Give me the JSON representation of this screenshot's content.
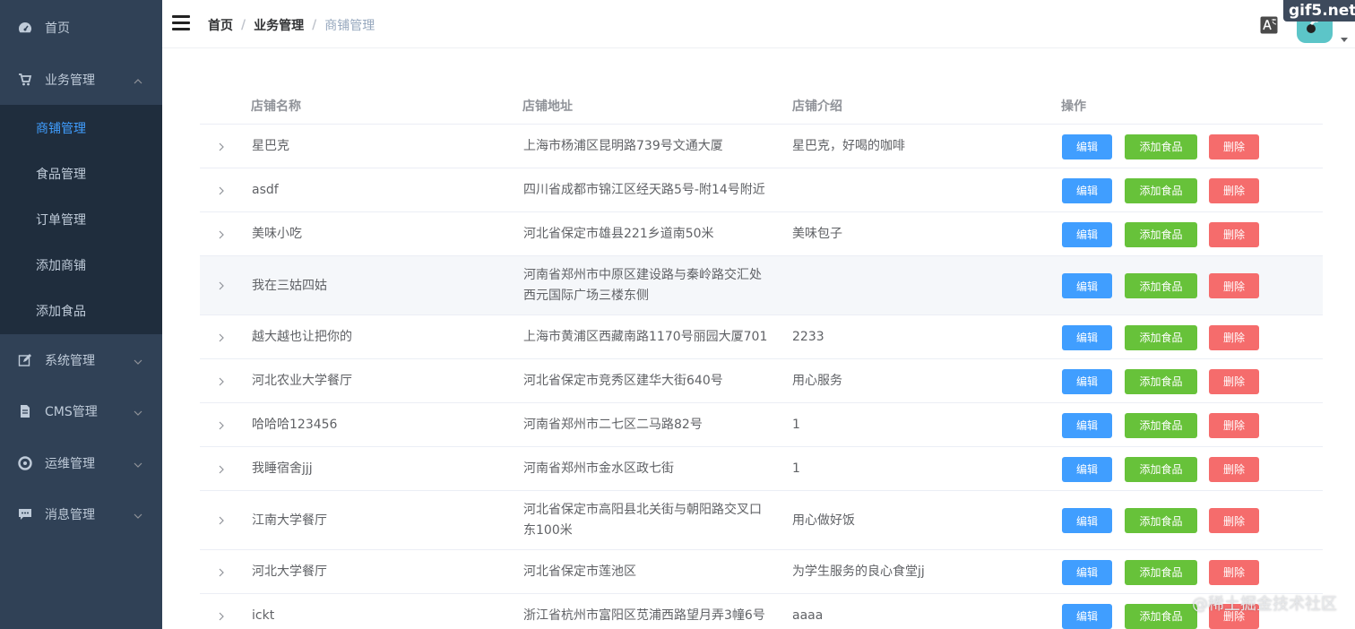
{
  "sidebar": {
    "top_items": [
      {
        "label": "首页",
        "icon": "dashboard-icon"
      },
      {
        "label": "业务管理",
        "icon": "cart-icon",
        "expanded": true
      }
    ],
    "sub_items": [
      {
        "label": "商铺管理",
        "active": true
      },
      {
        "label": "食品管理"
      },
      {
        "label": "订单管理"
      },
      {
        "label": "添加商铺"
      },
      {
        "label": "添加食品"
      }
    ],
    "bottom_items": [
      {
        "label": "系统管理",
        "icon": "edit-icon"
      },
      {
        "label": "CMS管理",
        "icon": "document-icon"
      },
      {
        "label": "运维管理",
        "icon": "settings-icon"
      },
      {
        "label": "消息管理",
        "icon": "message-icon"
      }
    ]
  },
  "header": {
    "breadcrumb": [
      "首页",
      "业务管理",
      "商铺管理"
    ],
    "separator": "/",
    "watermark": "gif5.net"
  },
  "table": {
    "columns": [
      "店铺名称",
      "店铺地址",
      "店铺介绍",
      "操作"
    ],
    "actions": {
      "edit": "编辑",
      "add_food": "添加食品",
      "delete": "删除"
    },
    "rows": [
      {
        "name": "星巴克",
        "address": "上海市杨浦区昆明路739号文通大厦",
        "intro": "星巴克，好喝的咖啡"
      },
      {
        "name": "asdf",
        "address": "四川省成都市锦江区经天路5号-附14号附近",
        "intro": ""
      },
      {
        "name": "美味小吃",
        "address": "河北省保定市雄县221乡道南50米",
        "intro": "美味包子"
      },
      {
        "name": "我在三姑四姑",
        "address": "河南省郑州市中原区建设路与秦岭路交汇处西元国际广场三楼东侧",
        "intro": ""
      },
      {
        "name": "越大越也让把你的",
        "address": "上海市黄浦区西藏南路1170号丽园大厦701",
        "intro": "2233"
      },
      {
        "name": "河北农业大学餐厅",
        "address": "河北省保定市竞秀区建华大街640号",
        "intro": "用心服务"
      },
      {
        "name": "哈哈哈123456",
        "address": "河南省郑州市二七区二马路82号",
        "intro": "1"
      },
      {
        "name": "我睡宿舍jjj",
        "address": "河南省郑州市金水区政七街",
        "intro": "1"
      },
      {
        "name": "江南大学餐厅",
        "address": "河北省保定市高阳县北关街与朝阳路交叉口东100米",
        "intro": "用心做好饭"
      },
      {
        "name": "河北大学餐厅",
        "address": "河北省保定市莲池区",
        "intro": "为学生服务的良心食堂jj"
      },
      {
        "name": "ickt",
        "address": "浙江省杭州市富阳区苋浦西路望月弄3幢6号",
        "intro": "aaaa"
      }
    ]
  },
  "footer_watermark": "@稀土掘金技术社区",
  "colors": {
    "sidebar_bg": "#304156",
    "submenu_bg": "#1f2d3d",
    "active": "#409eff",
    "primary": "#409eff",
    "success": "#67c23a",
    "danger": "#f56c6c"
  }
}
